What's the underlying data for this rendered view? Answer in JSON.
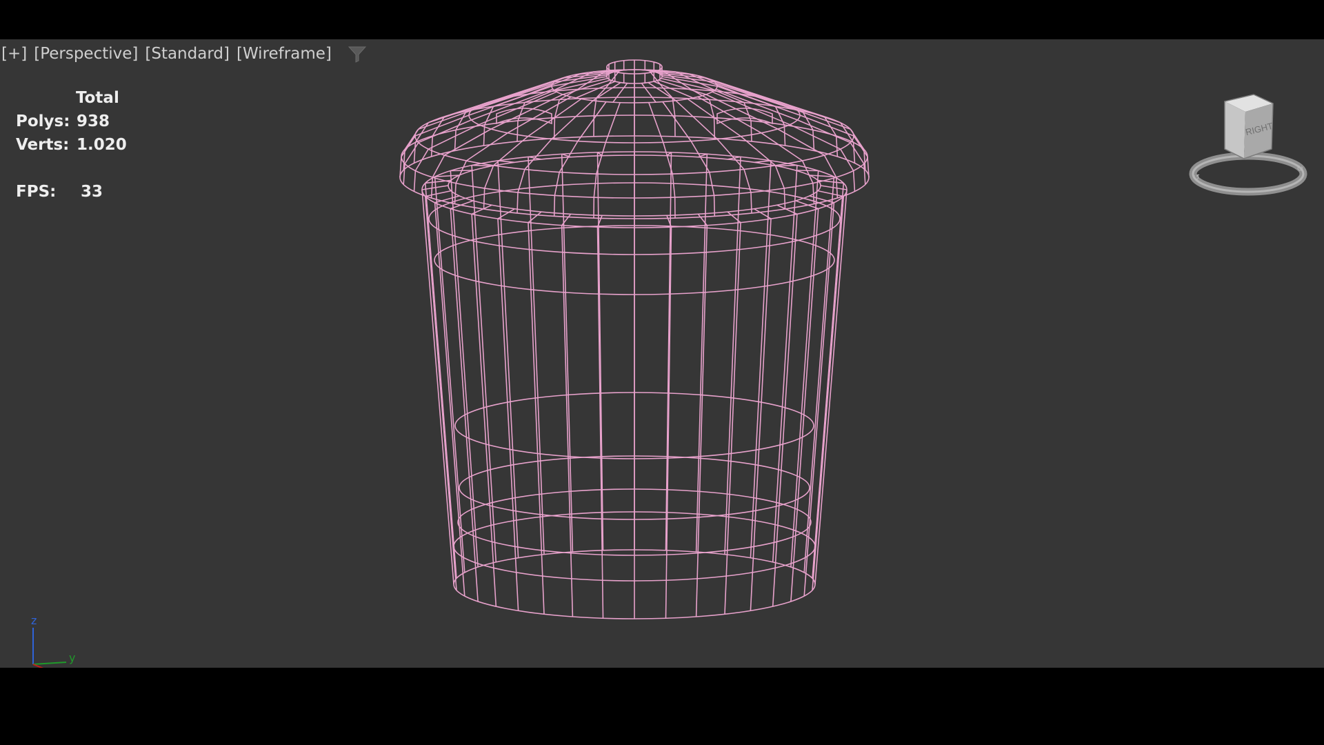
{
  "viewport": {
    "labels": [
      "[+]",
      "[Perspective]",
      "[Standard]",
      "[Wireframe]"
    ],
    "filter_icon": "filter-funnel-icon"
  },
  "stats": {
    "header": "Total",
    "polys_label": "Polys:",
    "polys_value": "938",
    "verts_label": "Verts:",
    "verts_value": "1.020",
    "fps_label": "FPS:",
    "fps_value": "33"
  },
  "viewcube": {
    "face_label": "RIGHT"
  },
  "axis_gizmo": {
    "z_label": "z",
    "y_label": "y"
  },
  "colors": {
    "viewport_bg": "#363636",
    "wireframe": "#e8a2cc",
    "axis_z": "#2f63d8",
    "axis_y": "#1f9a2a",
    "axis_x": "#c21d1d"
  }
}
